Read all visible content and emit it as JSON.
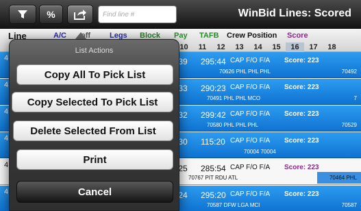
{
  "toolbar": {
    "filter_icon": "filter-icon",
    "percent_label": "%",
    "export_icon": "share-icon",
    "find_placeholder": "Find line #",
    "title": "WinBid Lines: Scored"
  },
  "header": {
    "line": "Line",
    "ac": "A/C",
    "off": "off",
    "legs": "Legs",
    "block": "Block",
    "pay": "Pay",
    "tafb": "TAFB",
    "crew_position": "Crew Position",
    "score": "Score",
    "days": [
      "10",
      "11",
      "12",
      "13",
      "14",
      "15",
      "16",
      "17",
      "18"
    ],
    "weekend_days": [
      "16"
    ]
  },
  "rows": [
    {
      "num": "4",
      "block": ":39",
      "tafb": "295:44",
      "crew": "CAP F/O F/A",
      "score": "Score: 223",
      "sub": "70626  PHL   PHL   PHL",
      "trail": "70492",
      "style": "blue"
    },
    {
      "num": "4",
      "block": ":33",
      "tafb": "290:23",
      "crew": "CAP F/O F/A",
      "score": "Score: 223",
      "sub": "70491  PHL   PHL   MCO",
      "trail": "7",
      "style": "blue"
    },
    {
      "num": "4",
      "block": ":32",
      "tafb": "299:42",
      "crew": "CAP F/O F/A",
      "score": "Score: 223",
      "sub": "70580  PHL   PHL   PHL",
      "trail": "70529",
      "style": "blue"
    },
    {
      "num": "4",
      "block": ":30",
      "tafb": "115:20",
      "crew": "CAP F/O F/A",
      "score": "Score: 223",
      "sub": "70004  70004",
      "trail": "",
      "style": "blue"
    },
    {
      "num": "4",
      "block": ":25",
      "tafb": "285:54",
      "crew": "CAP F/O F/A",
      "score": "Score: 223",
      "sub": "70767   PIT    RDU   ATL",
      "trail": "70464  PHL",
      "style": "white"
    },
    {
      "num": "4",
      "block": ":24",
      "tafb": "295:20",
      "crew": "CAP F/O F/A",
      "score": "Score: 223",
      "sub": "70587  DFW   LGA   MCI",
      "trail": "70587",
      "style": "blue"
    }
  ],
  "list_actions": {
    "title": "List Actions",
    "copy_all": "Copy All To Pick List",
    "copy_selected": "Copy Selected To Pick List",
    "delete_selected": "Delete Selected From List",
    "print": "Print",
    "cancel": "Cancel"
  }
}
